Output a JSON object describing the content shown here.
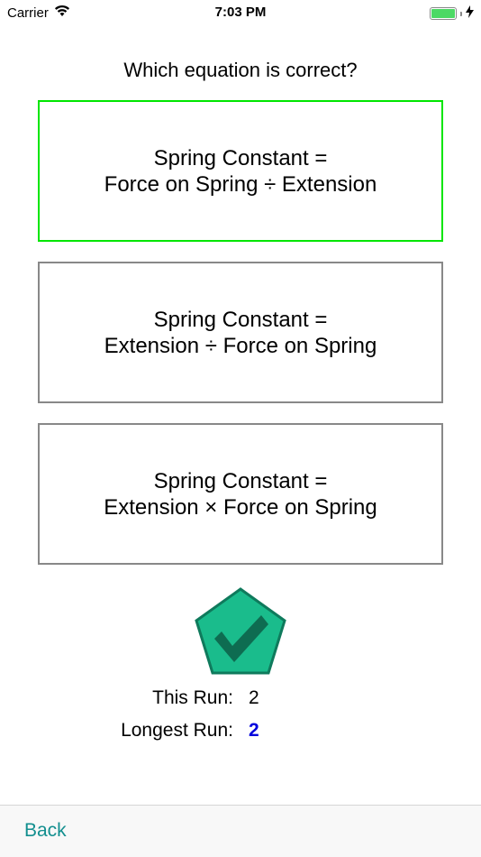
{
  "status_bar": {
    "carrier": "Carrier",
    "time": "7:03 PM",
    "battery_color": "#4cd964"
  },
  "quiz": {
    "question": "Which equation is correct?",
    "options": [
      {
        "line1": "Spring Constant =",
        "line2": "Force on Spring ÷ Extension",
        "selected": true
      },
      {
        "line1": "Spring Constant =",
        "line2": "Extension ÷ Force on Spring",
        "selected": false
      },
      {
        "line1": "Spring Constant =",
        "line2": "Extension × Force on Spring",
        "selected": false
      }
    ],
    "selected_border_color": "#00e600",
    "result_icon": "pentagon-checkmark-icon",
    "result_color": "#1abc8c"
  },
  "stats": {
    "this_run_label": "This Run:",
    "this_run_value": "2",
    "longest_run_label": "Longest Run:",
    "longest_run_value": "2",
    "longest_run_color": "#0000dd"
  },
  "nav": {
    "back_label": "Back",
    "back_color": "#138f8f"
  }
}
